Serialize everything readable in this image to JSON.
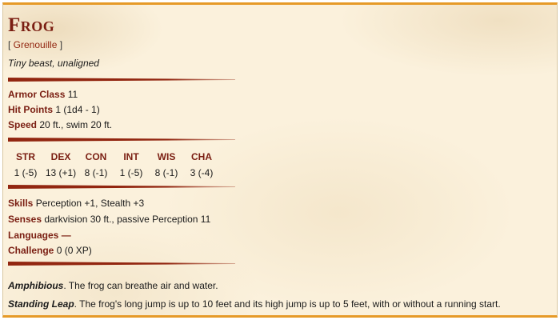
{
  "monster": {
    "name": "Frog",
    "alt_name": "Grenouille",
    "meta": "Tiny beast, unaligned"
  },
  "stats": {
    "armor_class": {
      "label": "Armor Class",
      "value": "11"
    },
    "hit_points": {
      "label": "Hit Points",
      "value": "1 (1d4 - 1)"
    },
    "speed": {
      "label": "Speed",
      "value": "20 ft., swim 20 ft."
    }
  },
  "abilities": [
    {
      "abbr": "STR",
      "score": "1 (-5)"
    },
    {
      "abbr": "DEX",
      "score": "13 (+1)"
    },
    {
      "abbr": "CON",
      "score": "8 (-1)"
    },
    {
      "abbr": "INT",
      "score": "1 (-5)"
    },
    {
      "abbr": "WIS",
      "score": "8 (-1)"
    },
    {
      "abbr": "CHA",
      "score": "3 (-4)"
    }
  ],
  "details": {
    "skills": {
      "label": "Skills",
      "value": "Perception +1, Stealth +3"
    },
    "senses": {
      "label": "Senses",
      "value": "darkvision 30 ft., passive Perception 11"
    },
    "languages": {
      "label": "Languages",
      "value": "—"
    },
    "challenge": {
      "label": "Challenge",
      "value": "0 (0 XP)"
    }
  },
  "traits": [
    {
      "name": "Amphibious",
      "text": "The frog can breathe air and water."
    },
    {
      "name": "Standing Leap",
      "text": "The frog's long jump is up to 10 feet and its high jump is up to 5 feet, with or without a running start."
    }
  ],
  "colors": {
    "accent": "#7a1e12",
    "rule": "#922610",
    "border": "#e69a28",
    "parchment": "#fbf1dc"
  }
}
